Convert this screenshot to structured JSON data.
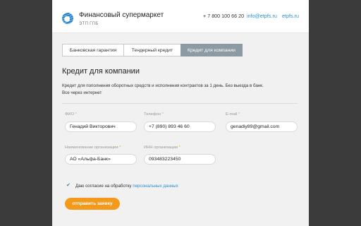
{
  "header": {
    "brand": "Финансовый супермаркет",
    "brand_sub": "ЭТП ГПБ",
    "phone": "+ 7 800 100 66 20",
    "email": "info@etpfs.ru",
    "site": "etpfs.ru"
  },
  "tabs": [
    {
      "label": "Банковская гарантия",
      "active": false
    },
    {
      "label": "Тендерный кредит",
      "active": false
    },
    {
      "label": "Кредит для компании",
      "active": true
    }
  ],
  "form": {
    "title": "Кредит для компании",
    "description_line1": "Кредит для пополнения оборотных средств и исполнения контрактов за 1 день. Без выезда в банк.",
    "description_line2": "Все через интернет",
    "fields": {
      "fio": {
        "label": "ФИО",
        "value": "Генадий Викторович"
      },
      "phone": {
        "label": "Телефон",
        "value": "+7 (890) 893 46 60"
      },
      "email": {
        "label": "E-mail",
        "value": "genadiy89@gmail.com"
      },
      "org_name": {
        "label": "Наименование организации",
        "value": "АО «Альфа-Банк»"
      },
      "inn": {
        "label": "ИНН организации",
        "value": "093483223450"
      }
    },
    "required_mark": "*",
    "consent_text": "Даю согласие на обработку",
    "consent_link": "персональных данных",
    "consent_checked": true,
    "submit_label": "отправить заявку"
  },
  "colors": {
    "accent": "#f39a1c",
    "link": "#2a8fd1",
    "active_tab": "#8c9aa3"
  }
}
